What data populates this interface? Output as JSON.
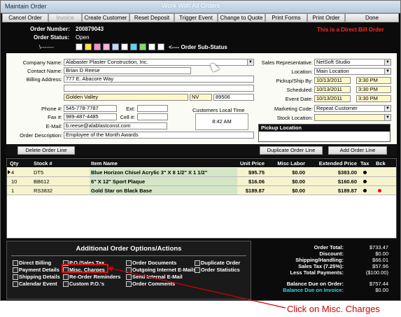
{
  "window": {
    "title": "Maintain Order",
    "center_title": "Work With All Orders"
  },
  "toolbar": [
    "Cancel Order",
    "Invoice",
    "Create Customer",
    "Reset Deposit",
    "Trigger Event",
    "Change to Quote",
    "Print Forms",
    "Print Order",
    "Done"
  ],
  "header": {
    "order_number_label": "Order Number:",
    "order_number": "200879043",
    "order_status_label": "Order Status:",
    "order_status": "Open",
    "direct_bill": "This is a Direct Bill Order",
    "sub_status_prefix": "\\-------",
    "sub_status_label": "<---- Order Sub-Status",
    "sub_status_colors": [
      "#ffffff",
      "#ffe24a",
      "#ff8fc8",
      "#ffb0d8",
      "#c4d4ff",
      "#ffffff",
      "#56d6ff",
      "#7cdc6a",
      "#ffffff",
      "#ffffff"
    ]
  },
  "customer": {
    "company_label": "Company Name:",
    "company": "Alabaster Plaster Construction, Inc.",
    "contact_label": "Contact Name:",
    "contact": "Brian D Reese",
    "address_label": "Billing Address:",
    "address1": "777 E. Abacore Way",
    "city": "Golden Valley",
    "state": "NV",
    "zip": "89506",
    "phone_label": "Phone #:",
    "phone": "545-778-7787",
    "ext_label": "Ext:",
    "fax_label": "Fax #:",
    "fax": "989-487-4485",
    "cell_label": "Cell #:",
    "email_label": "E-Mail:",
    "email": "b.reese@alablastconst.com",
    "desc_label": "Order Description:",
    "description": "Employee of the Month Awards",
    "local_time_label": "Customers Local Time",
    "local_time": "8:42 AM"
  },
  "order_info": {
    "sales_rep_label": "Sales Representative:",
    "sales_rep": "NetSoft Studio",
    "location_label": "Location:",
    "location": "Main Location",
    "pickup_label": "Pickup/Ship By:",
    "pickup_date": "10/13/2011",
    "pickup_time": "3:30 PM",
    "scheduled_label": "Scheduled:",
    "scheduled_date": "10/13/2011",
    "scheduled_time": "3:30 PM",
    "event_label": "Event Date:",
    "event_date": "10/13/2011",
    "event_time": "3:30 PM",
    "marketing_label": "Marketing Code:",
    "marketing": "Repeat Customer",
    "stock_label": "Stock Location:",
    "pickup_location_label": "Pickup Location"
  },
  "lines": {
    "delete_btn": "Delete Order Line",
    "duplicate_btn": "Duplicate Order Line",
    "add_btn": "Add Order Line",
    "columns": [
      "Qty",
      "Stock #",
      "Item Name",
      "Unit Price",
      "Misc Labor",
      "Extended Price",
      "Tax",
      "Bck"
    ],
    "rows": [
      {
        "qty": "4",
        "stock": "DT5",
        "item": "Blue Horizon Chisel Acrylic 3\" X 8 1/2\" X 1 1/2\"",
        "unit": "$95.75",
        "labor": "$0.00",
        "ext": "$383.00",
        "tax": true,
        "bck": false
      },
      {
        "qty": "10",
        "stock": "BB612",
        "item": "6\" X 12\" Sport Plaque",
        "unit": "$16.06",
        "labor": "$0.00",
        "ext": "$160.60",
        "tax": true,
        "bck": false
      },
      {
        "qty": "1",
        "stock": "RS3832",
        "item": "Gold Star on Black Base",
        "unit": "$189.87",
        "labor": "$0.00",
        "ext": "$189.87",
        "tax": true,
        "bck": true
      }
    ]
  },
  "options": {
    "title": "Additional Order Options/Actions",
    "col1": [
      "Direct Billing",
      "Payment Details",
      "Shipping Details",
      "Calendar Event"
    ],
    "col2": [
      "P.O./Sales Tax",
      "Misc. Charges",
      "Re-Order Reminders",
      "Custom P.O.'s"
    ],
    "col3": [
      "Order Documents",
      "Outgoing Internet E-Mails",
      "Send Internal E-Mail",
      "Order Comments"
    ],
    "col4": [
      "Duplicate Order",
      "Order Statistics"
    ]
  },
  "totals": {
    "order_total_label": "Order Total:",
    "order_total": "$733.47",
    "discount_label": "Discount:",
    "discount": "$0.00",
    "shipping_label": "Shipping/Handling:",
    "shipping": "$66.01",
    "tax_label": "Sales Tax (7.25%):",
    "tax": "$57.96",
    "payments_label": "Less Total Payments:",
    "payments": "($100.00)",
    "balance_order_label": "Balance Due on Order:",
    "balance_order": "$757.44",
    "balance_invoice_label": "Balance Due on Invoice:",
    "balance_invoice": "$0.00"
  },
  "annotation": {
    "caption": "Click on Misc. Charges"
  }
}
